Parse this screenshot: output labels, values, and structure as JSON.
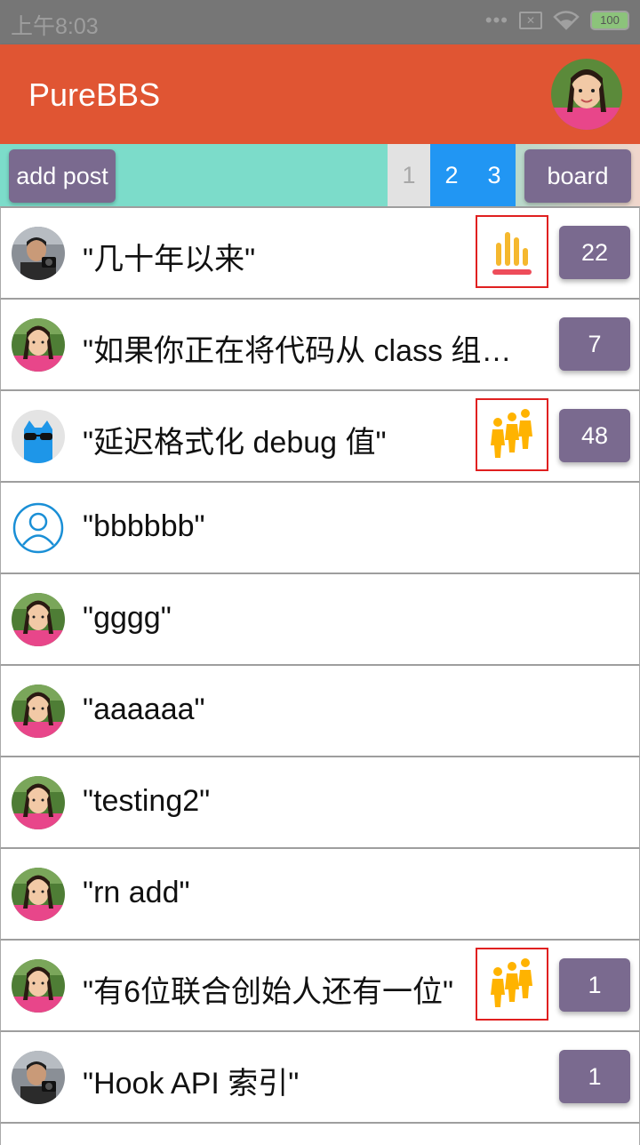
{
  "status_bar": {
    "time": "上午8:03",
    "battery": "100"
  },
  "app": {
    "title": "PureBBS"
  },
  "toolbar": {
    "add_post_label": "add post",
    "pages": [
      "1",
      "2",
      "3"
    ],
    "board_label": "board"
  },
  "posts": [
    {
      "title": "\"几十年以来\"",
      "avatar": "man-avatar",
      "badge": "bar-chart-icon",
      "count": "22"
    },
    {
      "title": "\"如果你正在将代码从 class 组件迁移\"",
      "avatar": "girl-avatar",
      "badge": null,
      "count": "7"
    },
    {
      "title": "\"延迟格式化 debug 值\"",
      "avatar": "cat-avatar",
      "badge": "people-group-icon",
      "count": "48"
    },
    {
      "title": "\"bbbbbb\"",
      "avatar": "default-user-avatar",
      "badge": null,
      "count": null
    },
    {
      "title": "\"gggg\"",
      "avatar": "girl-avatar",
      "badge": null,
      "count": null
    },
    {
      "title": "\"aaaaaa\"",
      "avatar": "girl-avatar",
      "badge": null,
      "count": null
    },
    {
      "title": "\"testing2\"",
      "avatar": "girl-avatar",
      "badge": null,
      "count": null
    },
    {
      "title": "\"rn add\"",
      "avatar": "girl-avatar",
      "badge": null,
      "count": null
    },
    {
      "title": "\"有6位联合创始人还有一位\"",
      "avatar": "girl-avatar",
      "badge": "people-group-icon",
      "count": "1"
    },
    {
      "title": "\"Hook API 索引\"",
      "avatar": "man-avatar",
      "badge": null,
      "count": "1"
    }
  ],
  "colors": {
    "appbar": "#e05533",
    "button": "#7a6a8f",
    "page_active": "#2196f3",
    "toolbar": "#7cdcca",
    "badge_border": "#e02020",
    "badge_people": "#ffb300"
  }
}
